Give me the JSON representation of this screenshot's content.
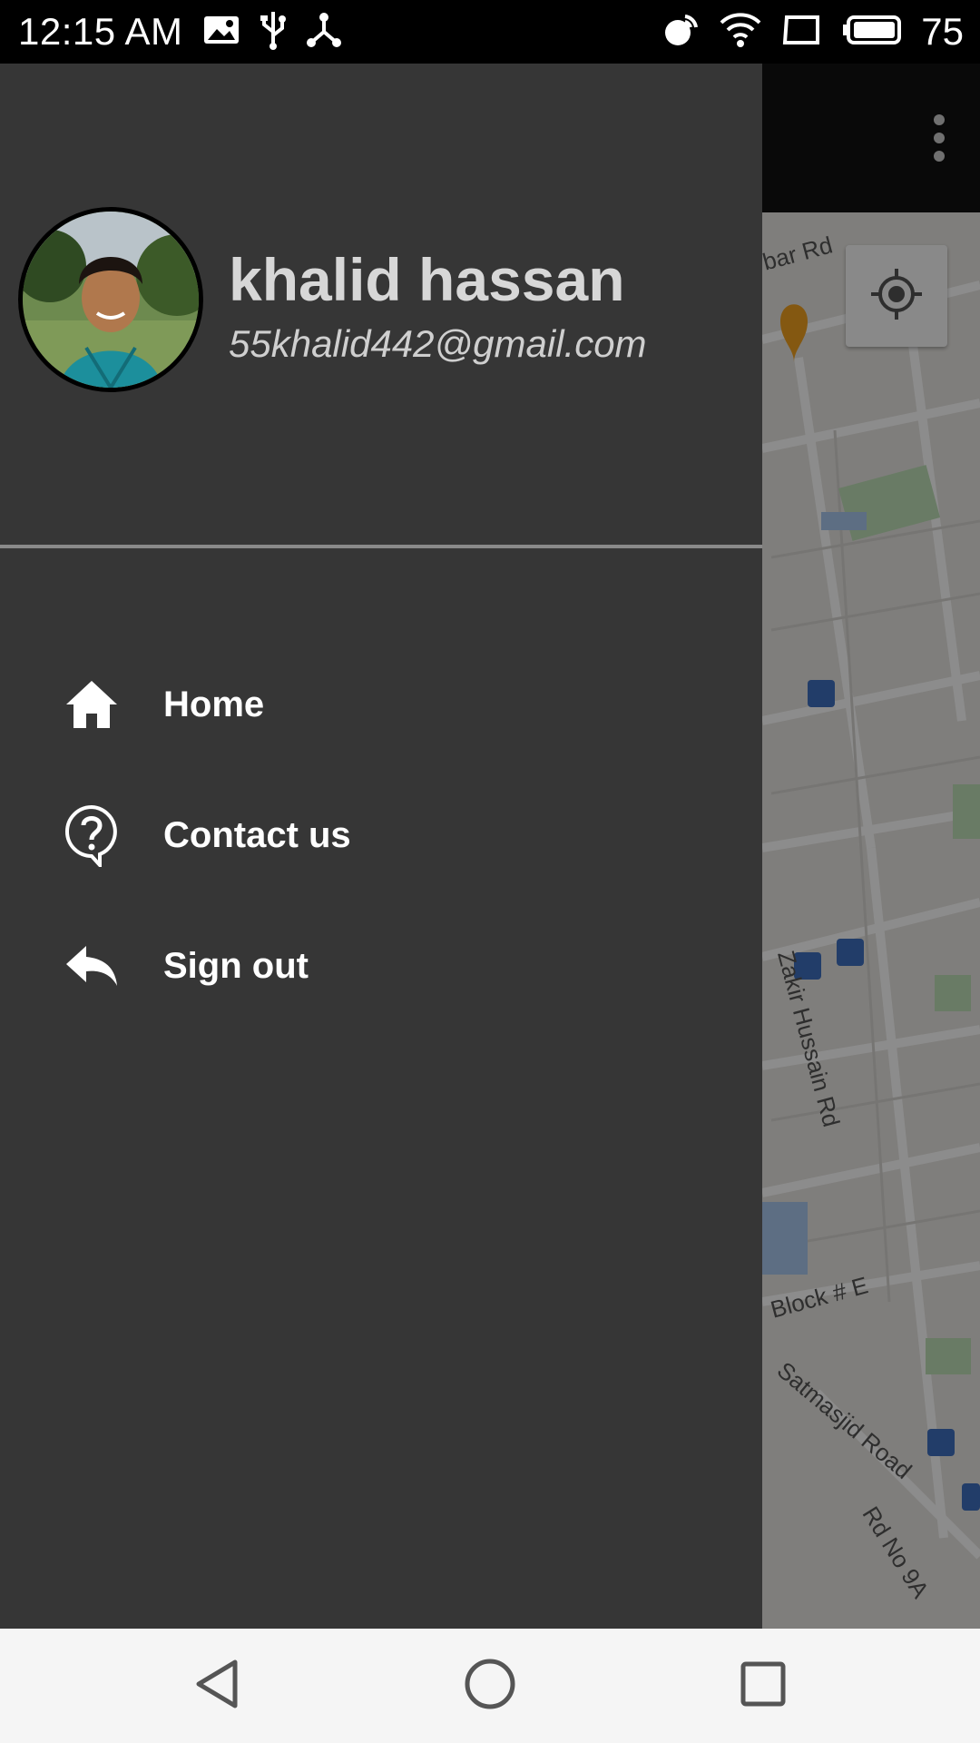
{
  "status_bar": {
    "time": "12:15 AM",
    "battery_level": "75",
    "icons_left": [
      "image-icon",
      "usb-icon",
      "share-icon"
    ],
    "icons_right": [
      "hotspot-icon",
      "wifi-icon",
      "screen-icon",
      "battery-icon"
    ]
  },
  "map": {
    "labels": {
      "road_top": "bar Rd",
      "zakir": "Zakir Hussain Rd",
      "block_e": "Block # E",
      "satmasjid": "Satmasjid Road",
      "rd_no_9a": "Rd No 9A"
    }
  },
  "drawer": {
    "user_name": "khalid hassan",
    "user_email": "55khalid442@gmail.com",
    "menu": [
      {
        "label": "Home",
        "icon": "home-icon"
      },
      {
        "label": "Contact us",
        "icon": "help-icon"
      },
      {
        "label": "Sign out",
        "icon": "reply-icon"
      }
    ]
  },
  "colors": {
    "drawer_bg": "#363636",
    "header_text": "#d7d7d7",
    "menu_text": "#ffffff",
    "navbar_bg": "#f5f5f5"
  }
}
